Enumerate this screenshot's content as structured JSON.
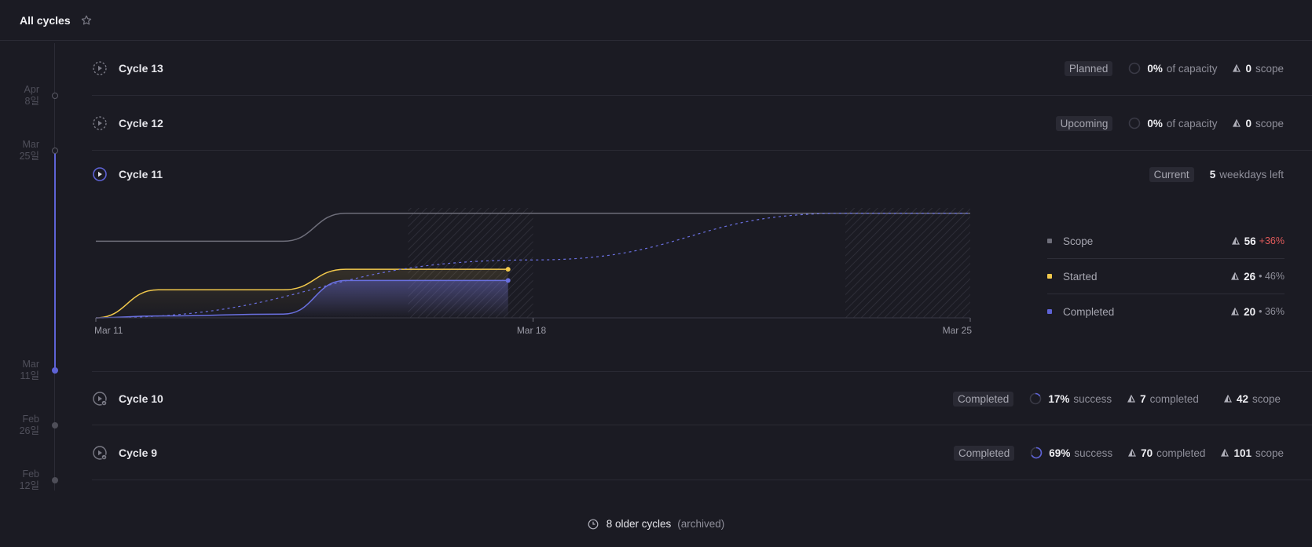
{
  "header": {
    "title": "All cycles",
    "star_icon": "star-icon"
  },
  "timeline": {
    "dates": [
      {
        "month": "Apr",
        "day": "8일"
      },
      {
        "month": "Mar",
        "day": "25일"
      },
      {
        "month": "Mar",
        "day": "11일"
      },
      {
        "month": "Feb",
        "day": "26일"
      },
      {
        "month": "Feb",
        "day": "12일"
      }
    ]
  },
  "cycles": {
    "c13": {
      "name": "Cycle 13",
      "status": "Planned",
      "capacity_value": "0%",
      "capacity_label": "of capacity",
      "scope_value": "0",
      "scope_label": "scope"
    },
    "c12": {
      "name": "Cycle 12",
      "status": "Upcoming",
      "capacity_value": "0%",
      "capacity_label": "of capacity",
      "scope_value": "0",
      "scope_label": "scope"
    },
    "c11": {
      "name": "Cycle 11",
      "status": "Current",
      "days_value": "5",
      "days_label": "weekdays left"
    },
    "c10": {
      "name": "Cycle 10",
      "status": "Completed",
      "success_value": "17%",
      "success_label": "success",
      "completed_value": "7",
      "completed_label": "completed",
      "scope_value": "42",
      "scope_label": "scope"
    },
    "c9": {
      "name": "Cycle 9",
      "status": "Completed",
      "success_value": "69%",
      "success_label": "success",
      "completed_value": "70",
      "completed_label": "completed",
      "scope_value": "101",
      "scope_label": "scope"
    }
  },
  "legend": {
    "scope": {
      "label": "Scope",
      "value": "56",
      "delta": "+36%"
    },
    "started": {
      "label": "Started",
      "value": "26",
      "pct": "• 46%"
    },
    "completed": {
      "label": "Completed",
      "value": "20",
      "pct": "• 36%"
    }
  },
  "archived": {
    "label": "8 older cycles",
    "note": "(archived)"
  },
  "colors": {
    "accent": "#5e63d6",
    "started": "#f2c94c",
    "scope": "#6e6e7a",
    "negative": "#e05a5a"
  },
  "chart_data": {
    "type": "line",
    "x_ticks": [
      "Mar 11",
      "Mar 18",
      "Mar 25"
    ],
    "x_unit": "day",
    "series": [
      {
        "name": "Scope",
        "x": [
          "Mar 11",
          "Mar 13",
          "Mar 14",
          "Mar 15",
          "Mar 25"
        ],
        "values": [
          41,
          41,
          41,
          56,
          56
        ]
      },
      {
        "name": "Started",
        "x": [
          "Mar 11",
          "Mar 12",
          "Mar 14",
          "Mar 15",
          "Mar 17.6"
        ],
        "values": [
          0,
          15,
          15,
          26,
          26
        ]
      },
      {
        "name": "Completed",
        "x": [
          "Mar 11",
          "Mar 12",
          "Mar 14",
          "Mar 15",
          "Mar 17.6"
        ],
        "values": [
          0,
          1,
          2,
          20,
          20
        ]
      }
    ],
    "target_line": {
      "x": [
        "Mar 11",
        "Mar 18",
        "Mar 23",
        "Mar 25"
      ],
      "values": [
        0,
        31,
        56,
        56
      ]
    },
    "ylim": [
      0,
      60
    ]
  }
}
